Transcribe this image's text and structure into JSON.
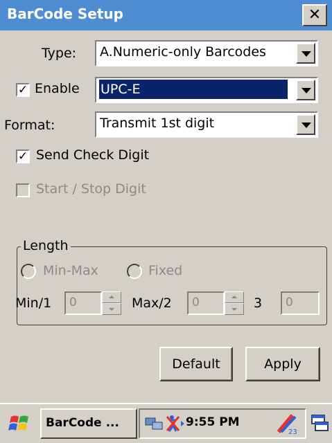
{
  "window": {
    "title": "BarCode Setup",
    "close_label": "✕"
  },
  "form": {
    "type_label": "Type:",
    "type_value": "A.Numeric-only Barcodes",
    "enable_label": "Enable",
    "enable_checked": true,
    "symbology_value": "UPC-E",
    "format_label": "Format:",
    "format_value": "Transmit 1st digit",
    "send_check_label": "Send Check Digit",
    "send_check_checked": true,
    "start_stop_label": "Start / Stop Digit",
    "start_stop_checked": false,
    "check_mark": "✓"
  },
  "length": {
    "legend": "Length",
    "minmax_label": "Min-Max",
    "fixed_label": "Fixed",
    "min_label": "Min/1",
    "min_value": "0",
    "max_label": "Max/2",
    "max_value": "0",
    "third_label": "3",
    "third_value": "0"
  },
  "buttons": {
    "default_label": "Default",
    "apply_label": "Apply"
  },
  "taskbar": {
    "app_label": "BarCode ...",
    "time": "9:55 PM"
  },
  "colors": {
    "titlebar": "#4f8dd2",
    "selection": "#0a246a",
    "face": "#d4d0c8"
  }
}
